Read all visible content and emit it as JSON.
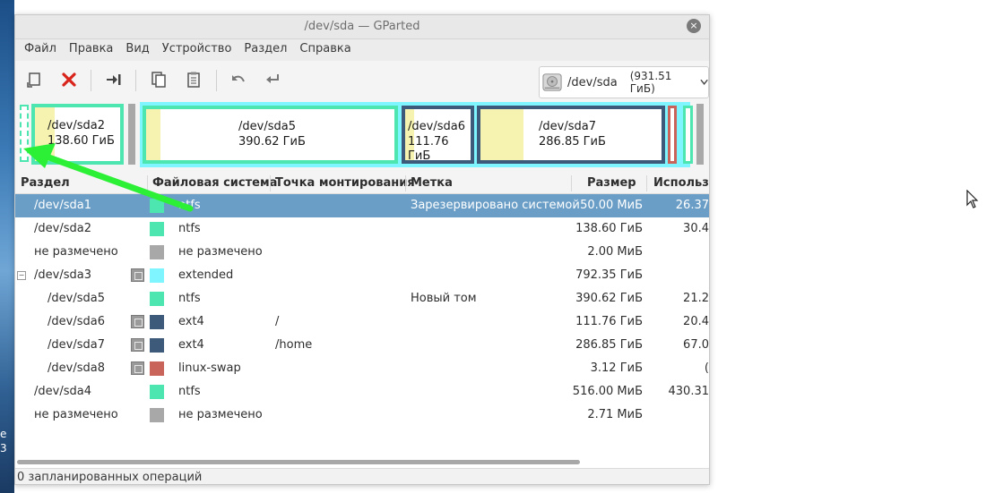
{
  "window": {
    "title": "/dev/sda — GParted",
    "close_glyph": "×"
  },
  "menu": [
    "Файл",
    "Правка",
    "Вид",
    "Устройство",
    "Раздел",
    "Справка"
  ],
  "toolbar": {
    "buttons": [
      "new-partition-icon",
      "delete-icon",
      "resize-move-icon",
      "copy-icon",
      "paste-icon",
      "undo-icon",
      "apply-icon"
    ]
  },
  "device_selector": {
    "name": "/dev/sda",
    "size": "(931.51 ГиБ)"
  },
  "partition_map": [
    {
      "name": "/dev/sda2",
      "size": "138.60 ГиБ"
    },
    {
      "name": "/dev/sda5",
      "size": "390.62 ГиБ"
    },
    {
      "name": "/dev/sda6",
      "size": "111.76 ГиБ"
    },
    {
      "name": "/dev/sda7",
      "size": "286.85 ГиБ"
    }
  ],
  "columns": [
    "Раздел",
    "Файловая система",
    "Точка монтирования",
    "Метка",
    "Размер",
    "Использо"
  ],
  "rows": [
    {
      "partition": "/dev/sda1",
      "fs": "ntfs",
      "mount": "",
      "label": "Зарезервировано системой",
      "size": "50.00 МиБ",
      "used": "26.37",
      "color": "#4ee6b0",
      "lock": false,
      "indent": false,
      "selected": true
    },
    {
      "partition": "/dev/sda2",
      "fs": "ntfs",
      "mount": "",
      "label": "",
      "size": "138.60 ГиБ",
      "used": "30.4",
      "color": "#4ee6b0",
      "lock": false,
      "indent": false,
      "selected": false
    },
    {
      "partition": "не размечено",
      "fs": "не размечено",
      "mount": "",
      "label": "",
      "size": "2.00 МиБ",
      "used": "",
      "color": "#a8a8a8",
      "lock": false,
      "indent": false,
      "selected": false
    },
    {
      "partition": "/dev/sda3",
      "fs": "extended",
      "mount": "",
      "label": "",
      "size": "792.35 ГиБ",
      "used": "",
      "color": "#7ff5ff",
      "lock": true,
      "indent": false,
      "expander": "−",
      "selected": false
    },
    {
      "partition": "/dev/sda5",
      "fs": "ntfs",
      "mount": "",
      "label": "Новый том",
      "size": "390.62 ГиБ",
      "used": "21.2",
      "color": "#4ee6b0",
      "lock": false,
      "indent": true,
      "selected": false
    },
    {
      "partition": "/dev/sda6",
      "fs": "ext4",
      "mount": "/",
      "label": "",
      "size": "111.76 ГиБ",
      "used": "20.4",
      "color": "#3e5a7a",
      "lock": true,
      "indent": true,
      "selected": false
    },
    {
      "partition": "/dev/sda7",
      "fs": "ext4",
      "mount": "/home",
      "label": "",
      "size": "286.85 ГиБ",
      "used": "67.0",
      "color": "#3e5a7a",
      "lock": true,
      "indent": true,
      "selected": false
    },
    {
      "partition": "/dev/sda8",
      "fs": "linux-swap",
      "mount": "",
      "label": "",
      "size": "3.12 ГиБ",
      "used": "(",
      "color": "#c8645a",
      "lock": true,
      "indent": true,
      "selected": false
    },
    {
      "partition": "/dev/sda4",
      "fs": "ntfs",
      "mount": "",
      "label": "",
      "size": "516.00 МиБ",
      "used": "430.31",
      "color": "#4ee6b0",
      "lock": false,
      "indent": false,
      "selected": false
    },
    {
      "partition": "не размечено",
      "fs": "не размечено",
      "mount": "",
      "label": "",
      "size": "2.71 МиБ",
      "used": "",
      "color": "#a8a8a8",
      "lock": false,
      "indent": false,
      "selected": false
    }
  ],
  "status": "0 запланированных операций",
  "wallpaper_text": [
    "e",
    "3"
  ]
}
